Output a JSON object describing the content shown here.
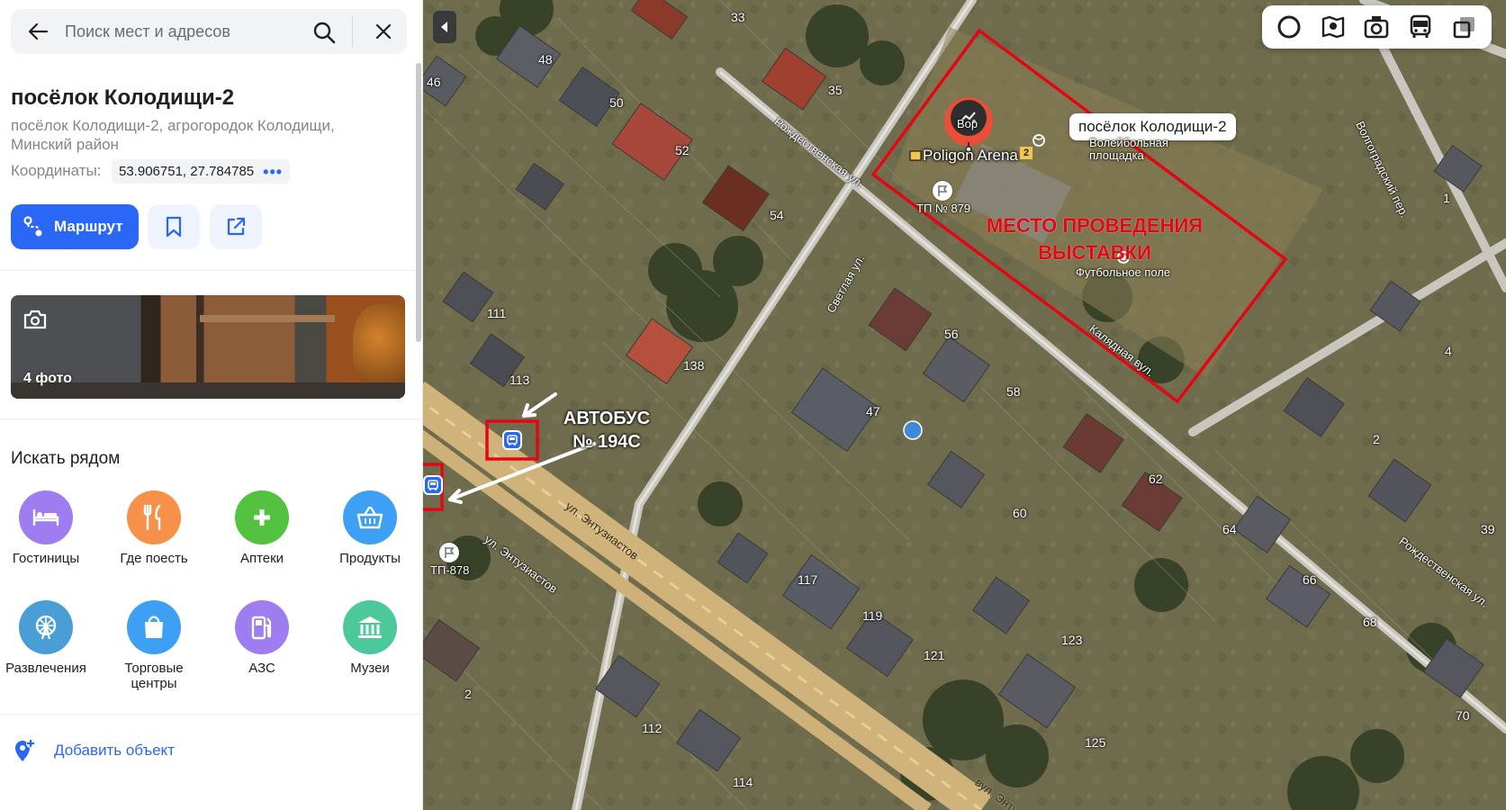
{
  "search": {
    "placeholder": "Поиск мест и адресов"
  },
  "place": {
    "title": "посёлок Колодищи-2",
    "address": "посёлок Колодищи-2, агрогородок Колодищи, Минский район",
    "coords_label": "Координаты:",
    "coords_value": "53.906751, 27.784785"
  },
  "actions": {
    "route_label": "Маршрут"
  },
  "photos": {
    "count_label": "4 фото"
  },
  "nearby": {
    "title": "Искать рядом",
    "categories": [
      {
        "label": "Гостиницы",
        "color": "#9d7df0",
        "icon": "bed-icon"
      },
      {
        "label": "Где поесть",
        "color": "#f7914a",
        "icon": "cutlery-icon"
      },
      {
        "label": "Аптеки",
        "color": "#53c23f",
        "icon": "pharmacy-cross-icon"
      },
      {
        "label": "Продукты",
        "color": "#3ea0f5",
        "icon": "basket-icon"
      },
      {
        "label": "Развлечения",
        "color": "#4a9ed6",
        "icon": "ferris-wheel-icon"
      },
      {
        "label": "Торговые центры",
        "color": "#3ea0f5",
        "icon": "shopping-bag-icon"
      },
      {
        "label": "АЗС",
        "color": "#9d7df0",
        "icon": "fuel-pump-icon"
      },
      {
        "label": "Музеи",
        "color": "#4cc89a",
        "icon": "museum-icon"
      }
    ]
  },
  "add_object": {
    "label": "Добавить объект"
  },
  "map": {
    "pin_callout": "посёлок Колодищи-2",
    "arena": "Poligon Arena",
    "arena_partial": "Вор",
    "arena_badge": "2",
    "volleyball": "Волейбольная площадка",
    "football": "Футбольное поле",
    "tp879": "ТП № 879",
    "tp878": "ТП-878",
    "venue_title": "МЕСТО ПРОВЕДЕНИЯ ВЫСТАВКИ",
    "bus_title": "АВТОБУС № 194С",
    "streets": {
      "rozhd1": "Рождественская ул.",
      "rozhd2": "Рождественская ул.",
      "svetlaya": "Светлая ул.",
      "kalyadnaya": "Калядная вул.",
      "volgograd": "Волгоградский пер.",
      "entuz1": "ул. Энтузиастов",
      "entuz2": "ул. Энтузиастов",
      "entuz3": "вул. Энту"
    },
    "house_numbers": [
      "33",
      "48",
      "46",
      "35",
      "50",
      "52",
      "54",
      "111",
      "113",
      "138",
      "56",
      "58",
      "47",
      "62",
      "60",
      "64",
      "117",
      "119",
      "121",
      "123",
      "66",
      "68",
      "2",
      "4",
      "1",
      "39",
      "112",
      "125",
      "114",
      "70",
      "2"
    ],
    "accent_red": "#e30613",
    "accent_blue": "#2a67f5"
  }
}
